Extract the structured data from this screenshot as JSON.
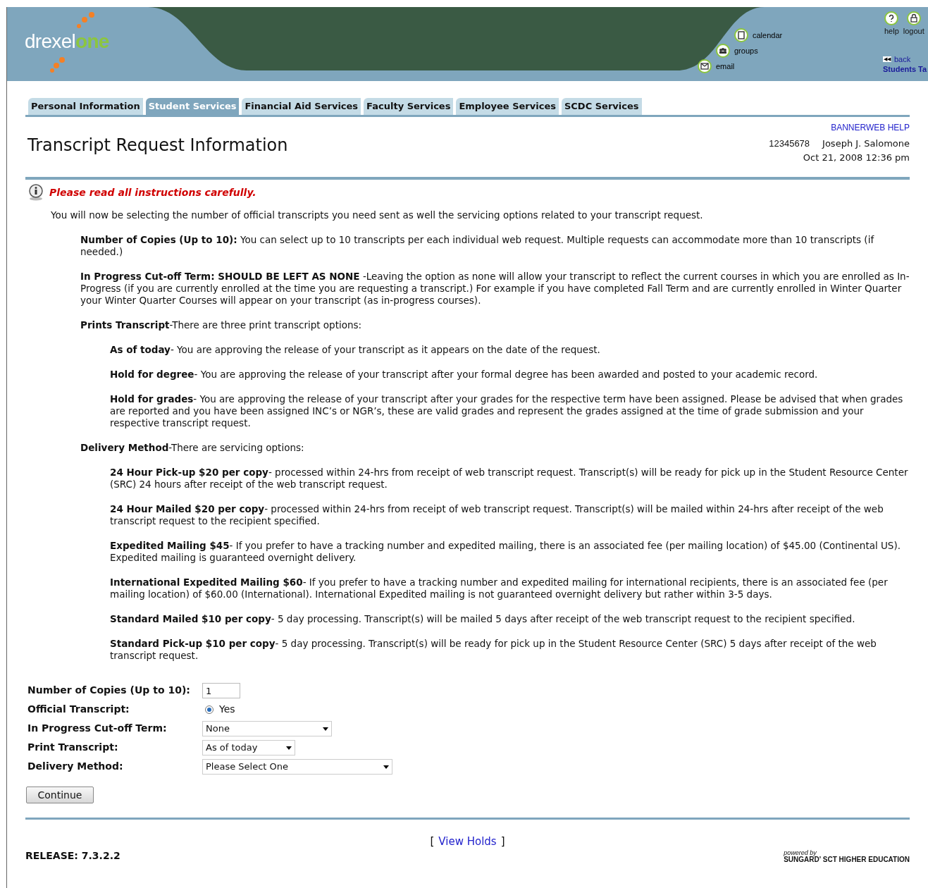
{
  "header": {
    "logo": {
      "part1": "drexel",
      "part2": "one"
    },
    "links": [
      {
        "kind": "calendar",
        "label": "calendar"
      },
      {
        "kind": "groups",
        "label": "groups"
      },
      {
        "kind": "email",
        "label": "email"
      }
    ],
    "top_links": [
      {
        "kind": "help",
        "label": "help"
      },
      {
        "kind": "logout",
        "label": "logout"
      }
    ],
    "back": {
      "icon": "◀◀",
      "label": "back",
      "sub": "Students Ta"
    }
  },
  "tabs": [
    {
      "label": "Personal Information",
      "selected": false
    },
    {
      "label": "Student Services",
      "selected": true
    },
    {
      "label": "Financial Aid Services",
      "selected": false
    },
    {
      "label": "Faculty Services",
      "selected": false
    },
    {
      "label": "Employee Services",
      "selected": false
    },
    {
      "label": "SCDC Services",
      "selected": false
    }
  ],
  "page": {
    "title": "Transcript Request Information",
    "help_link": "BANNERWEB HELP",
    "student_id": "12345678",
    "student_name": "Joseph J. Salomone",
    "datetime": "Oct 21, 2008 12:36 pm"
  },
  "notice": "Please read all instructions carefully.",
  "intro": "You will now be selecting the number of official transcripts you need sent as well the servicing options related to your transcript request.",
  "instructions": [
    {
      "text": "**Number of Copies (Up to 10):** You can select up to 10 transcripts per each individual web request. Multiple requests can accommodate more than 10 transcripts (if needed.)"
    },
    {
      "text": "**In Progress Cut-off Term: SHOULD BE LEFT AS NONE** -Leaving the option as none will allow your transcript to reflect the current courses in which you are enrolled as In-Progress (if you are currently enrolled at the time you are requesting a transcript.) For example if you have completed Fall Term and are currently enrolled in Winter Quarter your Winter Quarter Courses will appear on your transcript (as in-progress courses)."
    },
    {
      "text": "**Prints Transcript**-There are three print transcript options:",
      "children": [
        {
          "text": "**As of today**- You are approving the release of your transcript as it appears on the date of the request."
        },
        {
          "text": "**Hold for degree**- You are approving the release of your transcript after your formal degree has been awarded and posted to your academic record."
        },
        {
          "text": "**Hold for grades**- You are approving the release of your transcript after your grades for the respective term have been assigned. Please be advised that when grades are reported and you have been assigned INC’s or NGR’s, these are valid grades and represent the grades assigned at the time of grade submission and your respective transcript request."
        }
      ]
    },
    {
      "text": "**Delivery Method**-There are servicing options:",
      "children": [
        {
          "text": "**24 Hour Pick-up $20 per copy**- processed within 24-hrs from receipt of web transcript request. Transcript(s) will be ready for pick up in the Student Resource Center (SRC) 24 hours after receipt of the web transcript request."
        },
        {
          "text": "**24 Hour Mailed $20 per copy**- processed within 24-hrs from receipt of web transcript request. Transcript(s) will be mailed within 24-hrs after receipt of the web transcript request to the recipient specified."
        },
        {
          "text": "**Expedited Mailing $45**- If you prefer to have a tracking number and expedited mailing, there is an associated fee (per mailing location) of $45.00 (Continental US). Expedited mailing is guaranteed overnight delivery."
        },
        {
          "text": "**International Expedited Mailing $60**- If you prefer to have a tracking number and expedited mailing for international recipients, there is an associated fee (per mailing location) of $60.00 (International). International Expedited mailing is not guaranteed overnight delivery but rather within 3-5 days."
        },
        {
          "text": "**Standard Mailed $10 per copy**- 5 day processing. Transcript(s) will be mailed 5 days after receipt of the web transcript request to the recipient specified."
        },
        {
          "text": "**Standard Pick-up $10 per copy**- 5 day processing. Transcript(s) will be ready for pick up in the Student Resource Center (SRC) 5 days after receipt of the web transcript request."
        }
      ]
    }
  ],
  "form": [
    {
      "kind": "text",
      "label": "Number of Copies (Up to 10):",
      "value": "1"
    },
    {
      "kind": "radio",
      "label": "Official Transcript:",
      "option": "Yes",
      "selected": true
    },
    {
      "kind": "select",
      "label": "In Progress Cut-off Term:",
      "value": "None"
    },
    {
      "kind": "select",
      "label": "Print Transcript:",
      "value": "As of today"
    },
    {
      "kind": "select",
      "label": "Delivery Method:",
      "value": "Please Select One"
    }
  ],
  "continue_button": "Continue",
  "footer": {
    "open": "[",
    "link": "View Holds",
    "close": "]",
    "release": "RELEASE: 7.3.2.2",
    "powered_by": "powered by",
    "vendor": "SUNGARD' SCT HIGHER EDUCATION"
  }
}
